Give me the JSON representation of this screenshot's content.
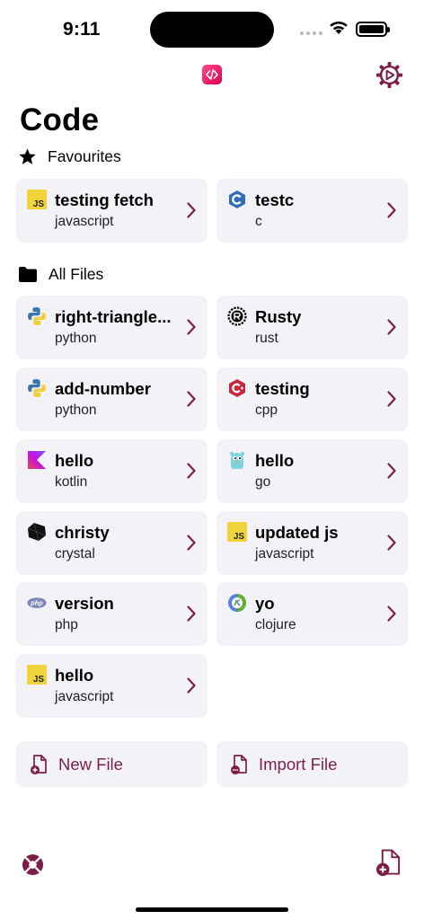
{
  "status_bar": {
    "time": "9:11"
  },
  "title": "Code",
  "favourites": {
    "label": "Favourites",
    "items": [
      {
        "name": "testing fetch",
        "lang": "javascript",
        "icon": "javascript-icon"
      },
      {
        "name": "testc",
        "lang": "c",
        "icon": "c-icon"
      }
    ]
  },
  "all_files": {
    "label": "All Files",
    "items": [
      {
        "name": "right-triangle...",
        "lang": "python",
        "icon": "python-icon"
      },
      {
        "name": "Rusty",
        "lang": "rust",
        "icon": "rust-icon"
      },
      {
        "name": "add-number",
        "lang": "python",
        "icon": "python-icon"
      },
      {
        "name": "testing",
        "lang": "cpp",
        "icon": "cpp-icon"
      },
      {
        "name": "hello",
        "lang": "kotlin",
        "icon": "kotlin-icon"
      },
      {
        "name": "hello",
        "lang": "go",
        "icon": "go-icon"
      },
      {
        "name": "christy",
        "lang": "crystal",
        "icon": "crystal-icon"
      },
      {
        "name": "updated js",
        "lang": "javascript",
        "icon": "javascript-icon"
      },
      {
        "name": "version",
        "lang": "php",
        "icon": "php-icon"
      },
      {
        "name": "yo",
        "lang": "clojure",
        "icon": "clojure-icon"
      },
      {
        "name": "hello",
        "lang": "javascript",
        "icon": "javascript-icon"
      }
    ]
  },
  "actions": {
    "new_file": "New File",
    "import_file": "Import File"
  },
  "icon_text": {
    "js": "JS",
    "php": "php"
  },
  "colors": {
    "accent": "#7b1f4a",
    "card_bg": "#f2f2f7"
  }
}
